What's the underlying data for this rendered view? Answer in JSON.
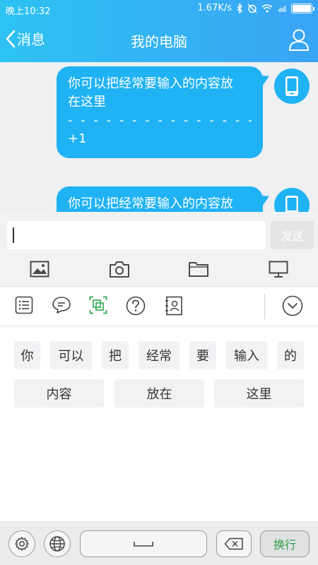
{
  "status_bar": {
    "time": "晚上10:32",
    "speed": "1.67K/s",
    "battery_level": 1.0
  },
  "header": {
    "back_label": "消息",
    "title": "我的电脑"
  },
  "messages": [
    {
      "line1": "你可以把经常要输入的内容放",
      "line2": "在这里",
      "dashes": "- - - - - - - - - - - - - - -",
      "line3": "+1"
    },
    {
      "line1": "你可以把经常要输入的内容放"
    }
  ],
  "composer": {
    "input_value": "",
    "send_label": "发送"
  },
  "attach_toolbar": [
    "image-icon",
    "camera-icon",
    "folder-icon",
    "computer-icon"
  ],
  "keyboard_toolbar": [
    "list-icon",
    "chat-bubble-icon",
    "copy-icon",
    "help-icon",
    "contact-card-icon",
    "collapse-icon"
  ],
  "suggestions": {
    "row1": [
      "你",
      "可以",
      "把",
      "经常",
      "要",
      "输入",
      "的"
    ],
    "row2": [
      "内容",
      "放在",
      "这里"
    ]
  },
  "keyboard": {
    "enter_label": "换行"
  },
  "colors": {
    "header_gradient_start": "#2ec2f3",
    "header_gradient_end": "#39a4f5",
    "bubble": "#1fb2f4",
    "enter_text": "#2f9d48"
  }
}
